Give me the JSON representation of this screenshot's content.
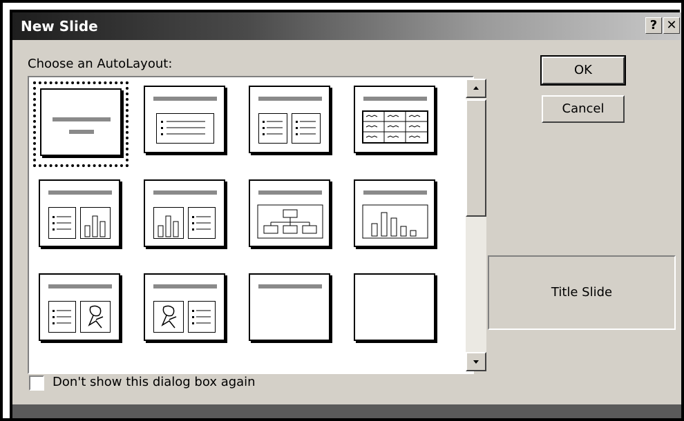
{
  "dialog": {
    "title": "New Slide",
    "help_label": "?",
    "close_label": "✕",
    "choose_label": "Choose an AutoLayout:",
    "ok_label": "OK",
    "cancel_label": "Cancel",
    "preview_label": "Title Slide",
    "checkbox_label": "Don't show this dialog box again",
    "checkbox_checked": false
  },
  "layouts": [
    {
      "icon": "title-slide-layout-icon",
      "selected": true
    },
    {
      "icon": "bulleted-list-layout-icon",
      "selected": false
    },
    {
      "icon": "two-column-text-layout-icon",
      "selected": false
    },
    {
      "icon": "table-layout-icon",
      "selected": false
    },
    {
      "icon": "text-and-chart-layout-icon",
      "selected": false
    },
    {
      "icon": "chart-and-text-layout-icon",
      "selected": false
    },
    {
      "icon": "organization-chart-layout-icon",
      "selected": false
    },
    {
      "icon": "chart-layout-icon",
      "selected": false
    },
    {
      "icon": "text-and-clip-art-layout-icon",
      "selected": false
    },
    {
      "icon": "clip-art-and-text-layout-icon",
      "selected": false
    },
    {
      "icon": "title-only-layout-icon",
      "selected": false
    },
    {
      "icon": "blank-layout-icon",
      "selected": false
    }
  ],
  "icons": {
    "scroll_up": "scroll-up-arrow-icon",
    "scroll_down": "scroll-down-arrow-icon"
  }
}
